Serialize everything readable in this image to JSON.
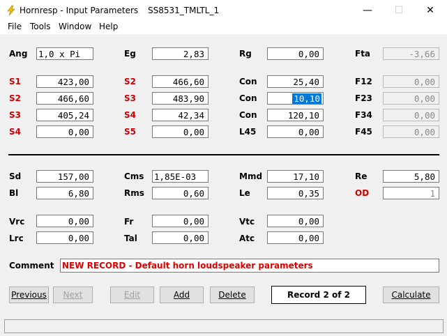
{
  "window": {
    "app_name": "Hornresp - Input Parameters",
    "record_name": "SS8531_TMLTL_1",
    "minimize_glyph": "—",
    "maximize_glyph": "☐",
    "close_glyph": "✕"
  },
  "menu": [
    "File",
    "Tools",
    "Window",
    "Help"
  ],
  "params": {
    "Ang": "1,0 x Pi",
    "Eg": "2,83",
    "Rg": "0,00",
    "Fta": "-3,66",
    "S1": "423,00",
    "S2a": "466,60",
    "Con1": "25,40",
    "F12": "0,00",
    "S2b": "466,60",
    "S3a": "483,90",
    "Con2": "10,10",
    "F23": "0,00",
    "S3b": "405,24",
    "S4a": "42,34",
    "Con3": "120,10",
    "F34": "0,00",
    "S4b": "0,00",
    "S5": "0,00",
    "L45": "0,00",
    "F45": "0,00",
    "Sd": "157,00",
    "Cms": "1,85E-03",
    "Mmd": "17,10",
    "Re": "5,80",
    "Bl": "6,80",
    "Rms": "0,60",
    "Le": "0,35",
    "OD": "1",
    "Vrc": "0,00",
    "Fr": "0,00",
    "Vtc": "0,00",
    "Lrc": "0,00",
    "Tal": "0,00",
    "Atc": "0,00"
  },
  "labels": {
    "Ang": "Ang",
    "Eg": "Eg",
    "Rg": "Rg",
    "Fta": "Fta",
    "S1": "S1",
    "S2": "S2",
    "S3": "S3",
    "S4": "S4",
    "S5": "S5",
    "Con": "Con",
    "L45": "L45",
    "F12": "F12",
    "F23": "F23",
    "F34": "F34",
    "F45": "F45",
    "Sd": "Sd",
    "Cms": "Cms",
    "Mmd": "Mmd",
    "Re": "Re",
    "Bl": "Bl",
    "Rms": "Rms",
    "Le": "Le",
    "OD": "OD",
    "Vrc": "Vrc",
    "Fr": "Fr",
    "Vtc": "Vtc",
    "Lrc": "Lrc",
    "Tal": "Tal",
    "Atc": "Atc",
    "Comment": "Comment"
  },
  "comment": "NEW RECORD - Default horn loudspeaker parameters",
  "buttons": {
    "previous": "Previous",
    "next": "Next",
    "edit": "Edit",
    "add": "Add",
    "delete": "Delete",
    "calculate": "Calculate"
  },
  "record_status": "Record 2 of 2",
  "colors": {
    "red_label": "#cc0000",
    "comment_text": "#e00000",
    "selection": "#0078d7"
  }
}
